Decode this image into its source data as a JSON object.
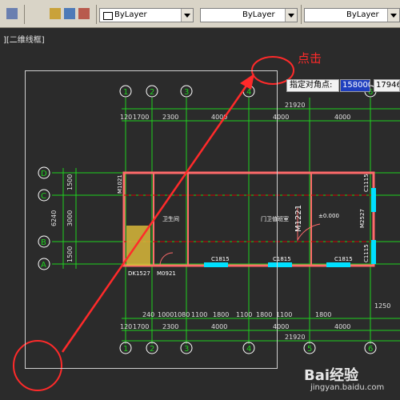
{
  "toolbar": {
    "layer_dropdown": "ByLayer",
    "linetype_dropdown": "ByLayer",
    "lineweight_dropdown": "ByLayer"
  },
  "viewport_label": "][二维线框]",
  "prompt": {
    "label": "指定对角点:",
    "x_value": "1580007",
    "y_value": "179469"
  },
  "annotation": "点击",
  "grid_axes": {
    "columns": [
      "1",
      "2",
      "3",
      "4",
      "5",
      "6"
    ],
    "rows": [
      "D",
      "C",
      "B",
      "A"
    ]
  },
  "dimensions": {
    "top_overall": "21920",
    "top_segments": [
      "120",
      "1700",
      "2300",
      "4000",
      "4000",
      "4000"
    ],
    "left_overall": "6240",
    "left_segments": [
      "1500",
      "120",
      "150",
      "3000",
      "150",
      "120",
      "1500"
    ],
    "bottom_detail": [
      "240",
      "1000",
      "1080",
      "1100",
      "1800",
      "1100",
      "1800",
      "1100",
      "1800"
    ],
    "bottom_right": "1250",
    "bottom_segments": [
      "120",
      "1700",
      "2300",
      "4000",
      "4000",
      "4000"
    ],
    "bottom_overall": "21920"
  },
  "plan_labels": {
    "room1": "卫生间",
    "room2": "门卫值班室",
    "door_main": "M1221",
    "door_side": "M2527",
    "level": "±0.000",
    "windows": [
      "C1815",
      "C1815",
      "C1815"
    ],
    "window_small": [
      "C1115",
      "C1115"
    ],
    "door_small": [
      "M1021",
      "M0921",
      "DK1527"
    ]
  },
  "watermark": {
    "main": "Bai经验",
    "sub": "jingyan.baidu.com"
  }
}
